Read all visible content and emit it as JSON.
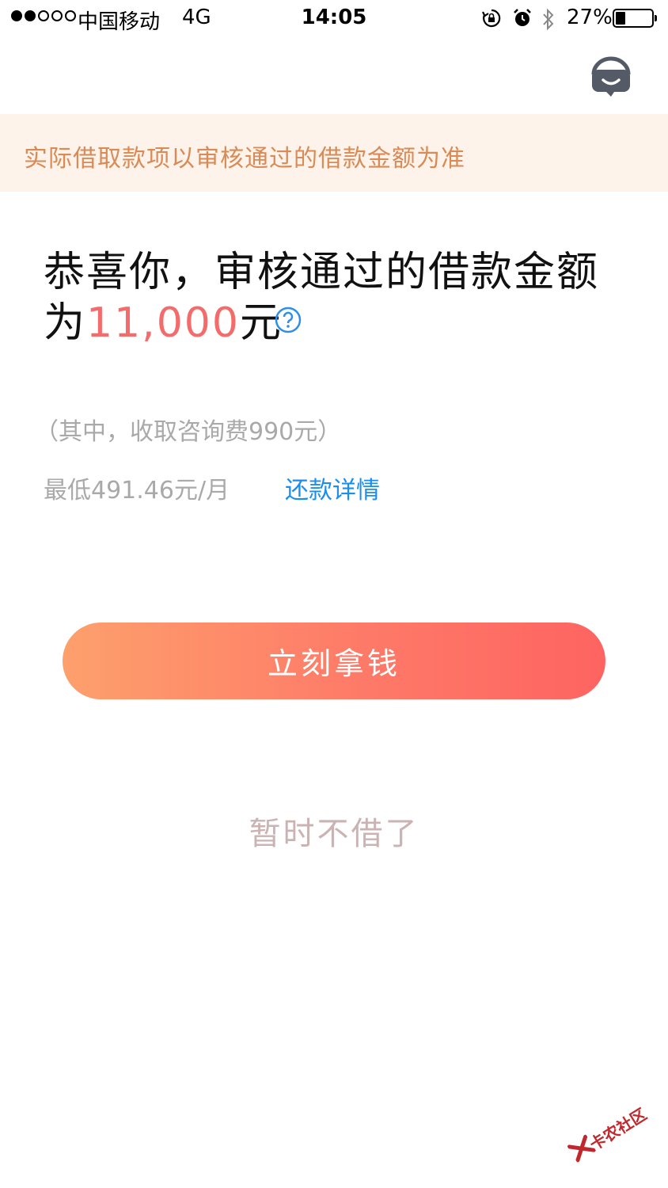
{
  "status_bar": {
    "signal_filled": 2,
    "signal_total": 5,
    "carrier": "中国移动",
    "network": "4G",
    "time": "14:05",
    "battery_percent": "27%",
    "battery_level": 0.27,
    "icons": [
      "rotation-lock-icon",
      "alarm-icon",
      "bluetooth-icon",
      "battery-icon"
    ]
  },
  "header": {
    "service_icon": "customer-service-icon"
  },
  "notice": {
    "text": "实际借取款项以审核通过的借款金额为准",
    "color": "#d98a55",
    "background": "#fdf3ea"
  },
  "result": {
    "headline_prefix": "恭喜你，审核通过的借款金额为",
    "amount": "11,000",
    "unit": "元",
    "amount_color": "#f36b6b",
    "help_icon": "question-circle-icon",
    "fee_note": "（其中，收取咨询费990元）",
    "monthly_min": "最低491.46元/月",
    "repay_link": "还款详情"
  },
  "actions": {
    "primary_label": "立刻拿钱",
    "secondary_label": "暂时不借了"
  },
  "watermark": {
    "text": "卡农社区"
  },
  "colors": {
    "accent_gradient_start": "#fda06c",
    "accent_gradient_end": "#fe6461",
    "link": "#1a8ef0",
    "muted_text": "#a9a9a9"
  }
}
